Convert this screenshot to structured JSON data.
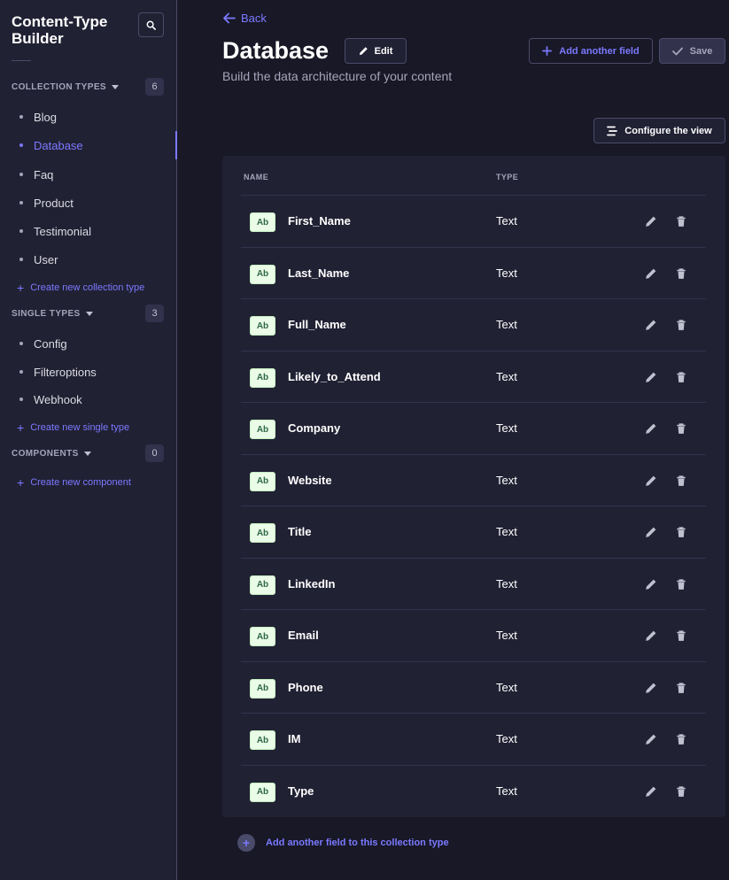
{
  "sidebar": {
    "title": "Content-Type Builder",
    "collection_types": {
      "label": "COLLECTION TYPES",
      "count": "6",
      "items": [
        "Blog",
        "Database",
        "Faq",
        "Product",
        "Testimonial",
        "User"
      ],
      "active": "Database",
      "create_label": "Create new collection type"
    },
    "single_types": {
      "label": "SINGLE TYPES",
      "count": "3",
      "items": [
        "Config",
        "Filteroptions",
        "Webhook"
      ],
      "create_label": "Create new single type"
    },
    "components": {
      "label": "COMPONENTS",
      "count": "0",
      "create_label": "Create new component"
    }
  },
  "header": {
    "back_label": "Back",
    "title": "Database",
    "edit_label": "Edit",
    "subtitle": "Build the data architecture of your content",
    "add_field_label": "Add another field",
    "save_label": "Save",
    "configure_label": "Configure the view"
  },
  "table": {
    "columns": [
      "NAME",
      "TYPE"
    ],
    "badge": "Ab",
    "rows": [
      {
        "name": "First_Name",
        "type": "Text"
      },
      {
        "name": "Last_Name",
        "type": "Text"
      },
      {
        "name": "Full_Name",
        "type": "Text"
      },
      {
        "name": "Likely_to_Attend",
        "type": "Text"
      },
      {
        "name": "Company",
        "type": "Text"
      },
      {
        "name": "Website",
        "type": "Text"
      },
      {
        "name": "Title",
        "type": "Text"
      },
      {
        "name": "LinkedIn",
        "type": "Text"
      },
      {
        "name": "Email",
        "type": "Text"
      },
      {
        "name": "Phone",
        "type": "Text"
      },
      {
        "name": "IM",
        "type": "Text"
      },
      {
        "name": "Type",
        "type": "Text"
      }
    ],
    "footer_add_label": "Add another field to this collection type"
  },
  "colors": {
    "accent": "#7b79ff",
    "background": "#181826",
    "panel": "#212134",
    "badge_bg": "#eafbe7",
    "badge_text": "#2f6846"
  },
  "icons": {
    "search": "search-icon",
    "back": "arrow-left-icon",
    "edit": "pencil-icon",
    "add": "plus-icon",
    "save": "check-icon",
    "configure": "list-settings-icon",
    "delete": "trash-icon",
    "caret": "caret-down-icon"
  }
}
